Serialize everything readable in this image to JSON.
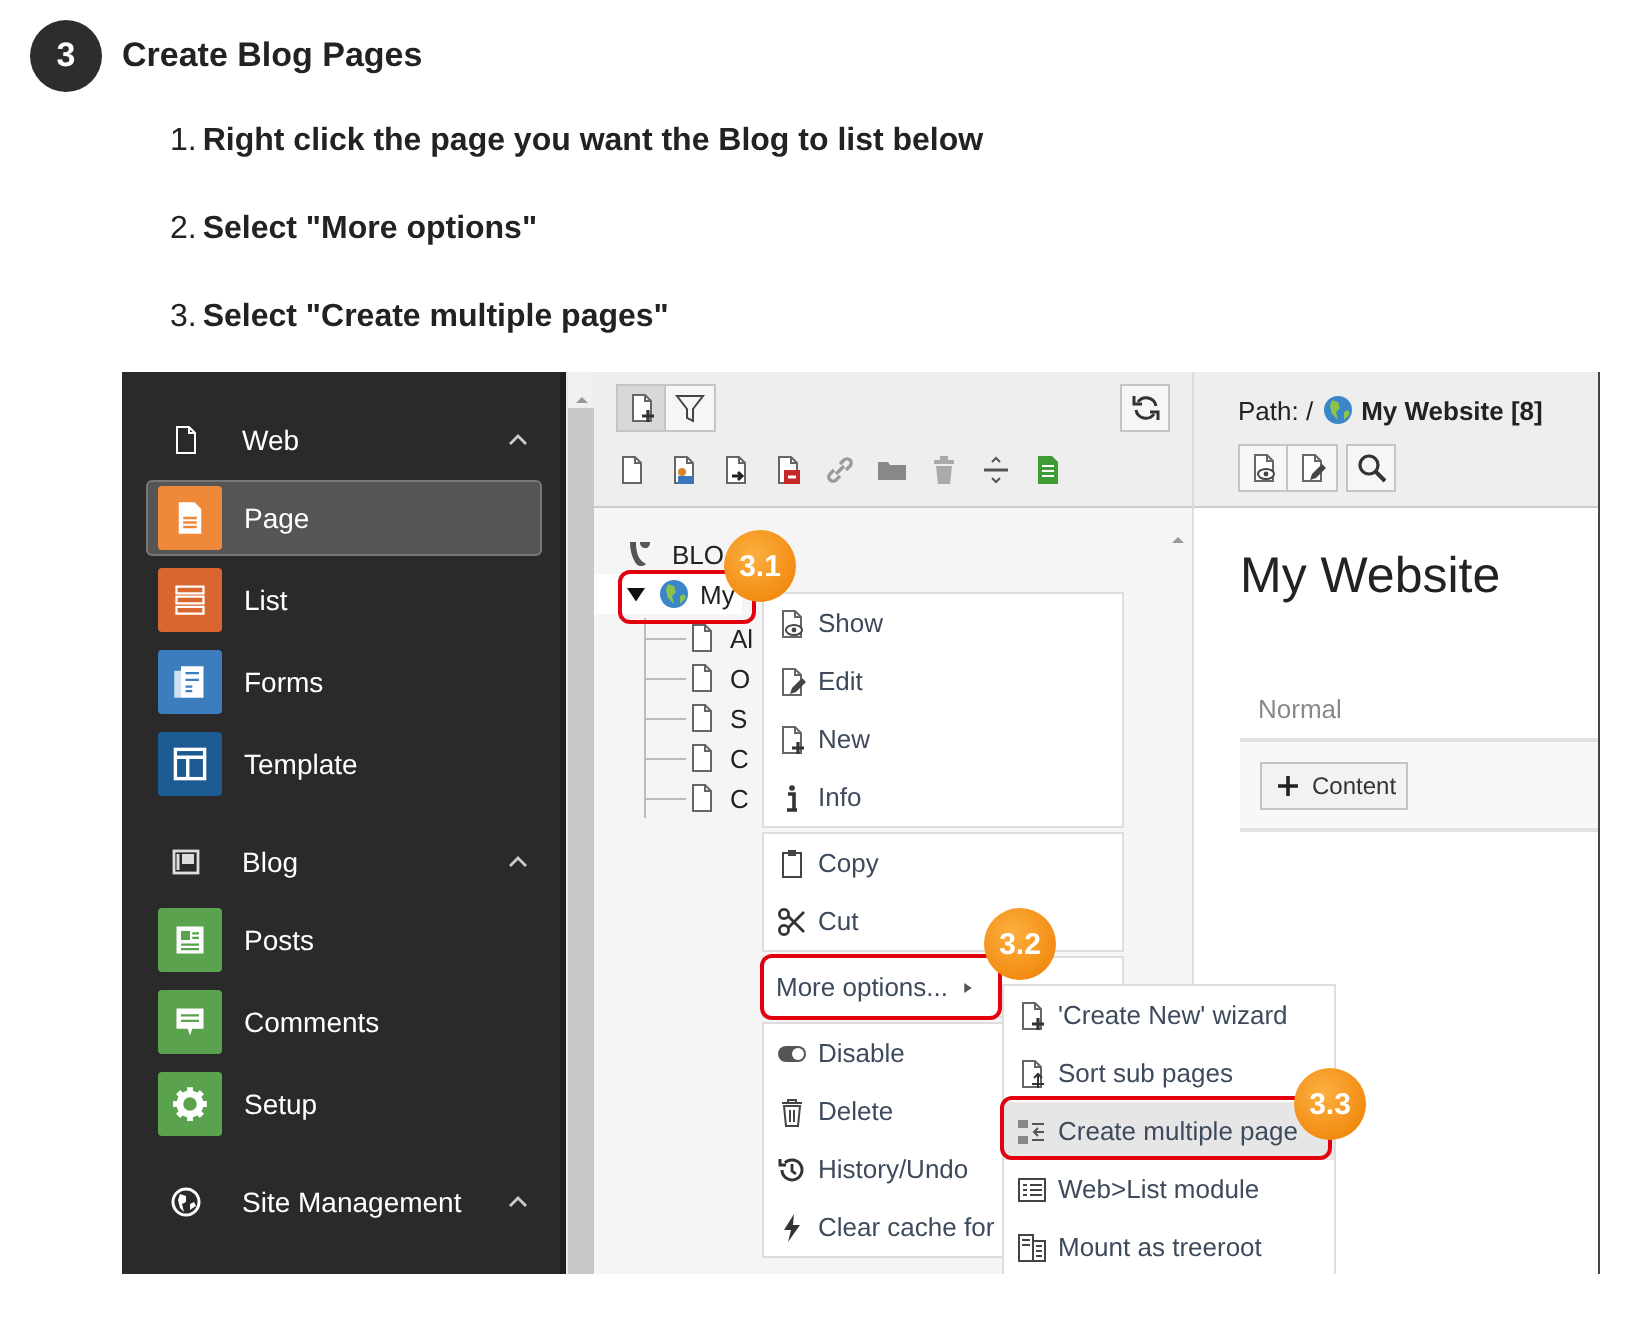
{
  "step": {
    "number": "3",
    "title": "Create Blog Pages"
  },
  "instructions": [
    {
      "number": "1.",
      "text": "Right click the page you want the Blog to list below"
    },
    {
      "number": "2.",
      "text": "Select \"More options\""
    },
    {
      "number": "3.",
      "text": "Select \"Create multiple pages\""
    }
  ],
  "sidebar": {
    "groups": [
      {
        "label": "Web",
        "expanded": true,
        "items": [
          {
            "label": "Page",
            "color": "#f0883a",
            "selected": true
          },
          {
            "label": "List",
            "color": "#d9662f",
            "selected": false
          },
          {
            "label": "Forms",
            "color": "#3b7dbd",
            "selected": false
          },
          {
            "label": "Template",
            "color": "#1c5a94",
            "selected": false
          }
        ]
      },
      {
        "label": "Blog",
        "expanded": true,
        "items": [
          {
            "label": "Posts",
            "color": "#5aa24d",
            "selected": false
          },
          {
            "label": "Comments",
            "color": "#5aa24d",
            "selected": false
          },
          {
            "label": "Setup",
            "color": "#5aa24d",
            "selected": false
          }
        ]
      },
      {
        "label": "Site Management",
        "expanded": true
      }
    ]
  },
  "page_tree": {
    "nodes": [
      {
        "label": "BLO",
        "selected": false,
        "children": [
          {
            "label": "My",
            "selected": true,
            "expanded": true,
            "children": [
              {
                "label": "Al",
                "selected": false
              },
              {
                "label": "O",
                "selected": false
              },
              {
                "label": "S",
                "selected": false
              },
              {
                "label": "C",
                "selected": false
              },
              {
                "label": "C",
                "selected": false
              }
            ]
          }
        ]
      }
    ]
  },
  "context_menu": {
    "groups": [
      [
        {
          "label": "Show",
          "kind": "action"
        },
        {
          "label": "Edit",
          "kind": "action"
        },
        {
          "label": "New",
          "kind": "action"
        },
        {
          "label": "Info",
          "kind": "action"
        }
      ],
      [
        {
          "label": "Copy",
          "kind": "action"
        },
        {
          "label": "Cut",
          "kind": "action"
        }
      ],
      [
        {
          "label": "More options...",
          "kind": "submenu"
        }
      ],
      [
        {
          "label": "Disable",
          "kind": "action"
        },
        {
          "label": "Delete",
          "kind": "action"
        },
        {
          "label": "History/Undo",
          "kind": "action"
        },
        {
          "label": "Clear cache for",
          "kind": "action"
        }
      ]
    ]
  },
  "submenu": [
    {
      "label": "'Create New' wizard",
      "selected": false
    },
    {
      "label": "Sort sub pages",
      "selected": false
    },
    {
      "label": "Create multiple page",
      "selected": true
    },
    {
      "label": "Web>List module",
      "selected": false
    },
    {
      "label": "Mount as treeroot",
      "selected": false
    }
  ],
  "callouts": [
    {
      "label": "3.1"
    },
    {
      "label": "3.2"
    },
    {
      "label": "3.3"
    }
  ],
  "content": {
    "path_label": "Path: /",
    "path_page": "My Website [8]",
    "title": "My Website",
    "column": "Normal",
    "add_button": "Content"
  }
}
